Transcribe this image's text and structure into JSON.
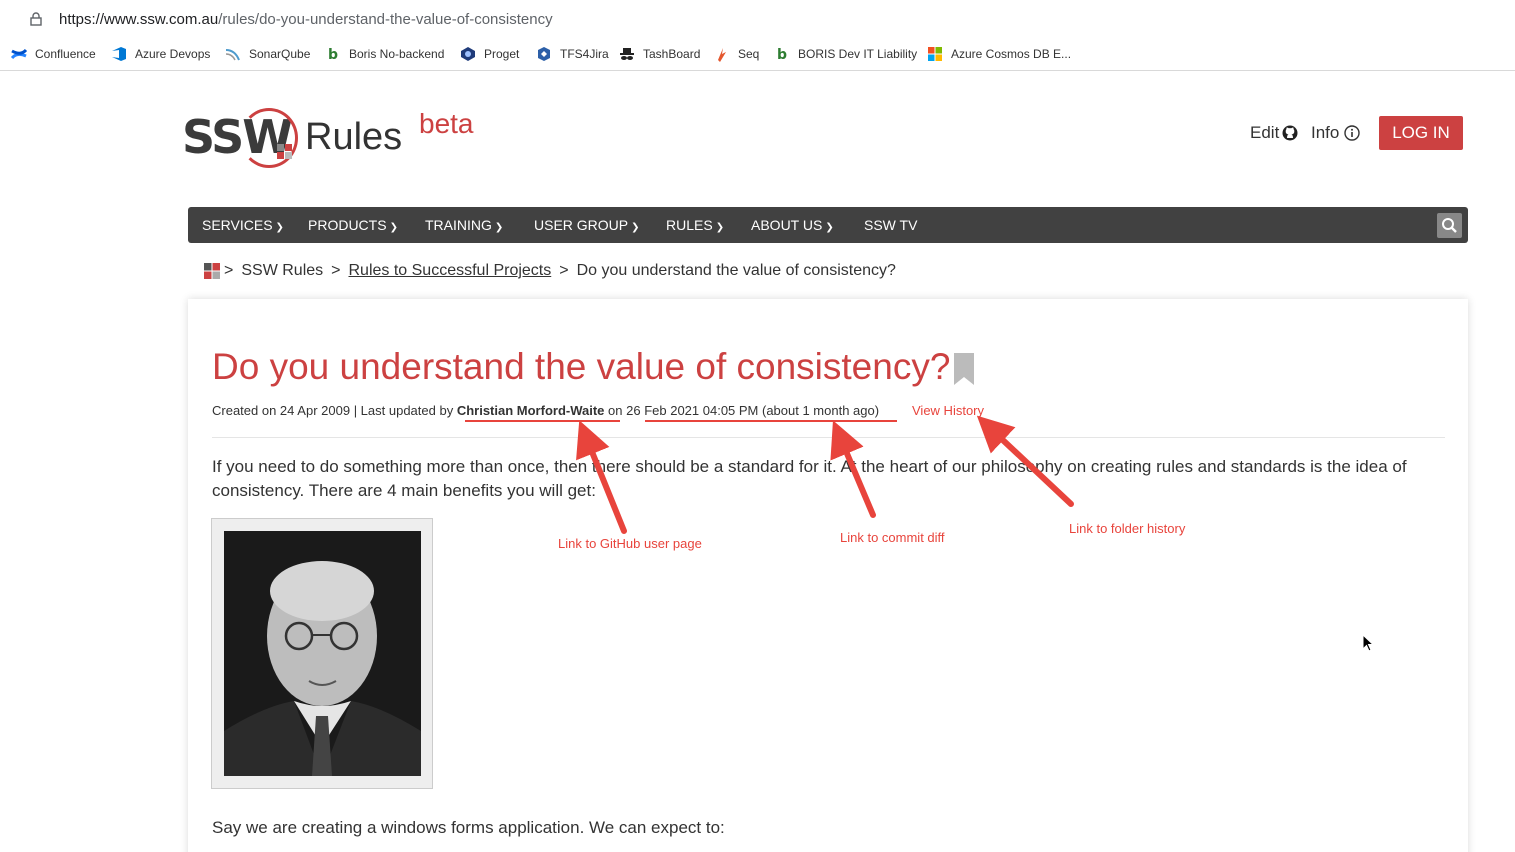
{
  "browser": {
    "url_host": "https://www.ssw.com.au",
    "url_path": "/rules/do-you-understand-the-value-of-consistency",
    "bookmarks": [
      {
        "label": "Confluence",
        "icon": "confluence-icon"
      },
      {
        "label": "Azure Devops",
        "icon": "azure-devops-icon"
      },
      {
        "label": "SonarQube",
        "icon": "sonarqube-icon"
      },
      {
        "label": "Boris No-backend",
        "icon": "boris-icon"
      },
      {
        "label": "Proget",
        "icon": "proget-icon"
      },
      {
        "label": "TFS4Jira",
        "icon": "tfs4jira-icon"
      },
      {
        "label": "TashBoard",
        "icon": "tashboard-icon"
      },
      {
        "label": "Seq",
        "icon": "seq-icon"
      },
      {
        "label": "BORIS Dev IT Liability",
        "icon": "boris-icon"
      },
      {
        "label": "Azure Cosmos DB E...",
        "icon": "microsoft-icon"
      }
    ]
  },
  "header": {
    "logo_ssw": "SSW",
    "logo_rules": "Rules",
    "logo_beta": "beta",
    "edit_label": "Edit",
    "info_label": "Info",
    "login_label": "LOG IN"
  },
  "nav": {
    "items": [
      "SERVICES",
      "PRODUCTS",
      "TRAINING",
      "USER GROUP",
      "RULES",
      "ABOUT US",
      "SSW TV"
    ]
  },
  "breadcrumb": {
    "home_sep": ">",
    "level1": "SSW Rules",
    "level2": "Rules to Successful Projects",
    "current": "Do you understand the value of consistency?",
    "sep": ">"
  },
  "article": {
    "title": "Do you understand the value of consistency?",
    "created_prefix": "Created on 24 Apr 2009",
    "updated_prefix": "| Last updated by",
    "author": "Christian Morford-Waite",
    "on_word": "on",
    "updated_date": "26 Feb 2021 04:05 PM (about 1 month ago)",
    "view_history": "View History",
    "intro": "If you need to do something more than once, then there should be a standard for it. At the heart of our philosophy on creating rules and standards is the idea of consistency. There are 4 main benefits you will get:",
    "followup": "Say we are creating a windows forms application. We can expect to:"
  },
  "annotations": {
    "github": "Link to GitHub user page",
    "commit": "Link to commit diff",
    "folder": "Link to folder history",
    "color": "#e8443c"
  },
  "colors": {
    "brand_red": "#cc4141",
    "nav_bg": "#414141"
  }
}
